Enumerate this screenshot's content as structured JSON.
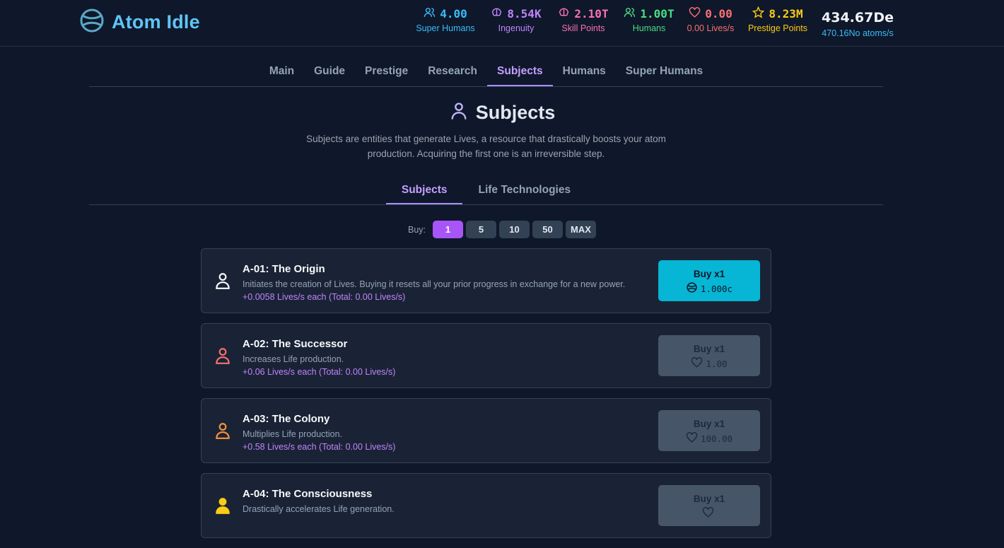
{
  "app": {
    "title": "Atom Idle"
  },
  "stats": [
    {
      "value": "4.00",
      "label": "Super Humans",
      "icon": "users-icon",
      "color": "#38bdf8"
    },
    {
      "value": "8.54K",
      "label": "Ingenuity",
      "icon": "brain-icon",
      "color": "#c084fc"
    },
    {
      "value": "2.10T",
      "label": "Skill Points",
      "icon": "brain-icon",
      "color": "#f472b6"
    },
    {
      "value": "1.00T",
      "label": "Humans",
      "icon": "users-icon",
      "color": "#4ade80"
    },
    {
      "value": "0.00",
      "label": "0.00 Lives/s",
      "icon": "heart-icon",
      "color": "#f87171"
    },
    {
      "value": "8.23M",
      "label": "Prestige Points",
      "icon": "star-icon",
      "color": "#facc15"
    }
  ],
  "atoms": {
    "value": "434.67De",
    "rate": "470.16No atoms/s"
  },
  "nav": {
    "tabs": [
      "Main",
      "Guide",
      "Prestige",
      "Research",
      "Subjects",
      "Humans",
      "Super Humans"
    ],
    "active": "Subjects"
  },
  "page": {
    "title": "Subjects",
    "description": "Subjects are entities that generate Lives, a resource that drastically boosts your atom production. Acquiring the first one is an irreversible step."
  },
  "subtabs": {
    "items": [
      "Subjects",
      "Life Technologies"
    ],
    "active": "Subjects"
  },
  "buy": {
    "label": "Buy:",
    "options": [
      "1",
      "5",
      "10",
      "50",
      "MAX"
    ],
    "active": "1"
  },
  "subjects": [
    {
      "name": "A-01: The Origin",
      "desc": "Initiates the creation of Lives. Buying it resets all your prior progress in exchange for a new power.",
      "prod": "+0.0058 Lives/s each (Total: 0.00 Lives/s)",
      "buy": "Buy x1",
      "cost": "1.000c",
      "cost_icon": "atom-icon",
      "icon_color": "#f8fafc",
      "enabled": true
    },
    {
      "name": "A-02: The Successor",
      "desc": "Increases Life production.",
      "prod": "+0.06 Lives/s each (Total: 0.00 Lives/s)",
      "buy": "Buy x1",
      "cost": "1.00",
      "cost_icon": "heart-icon",
      "icon_color": "#f87171",
      "enabled": false
    },
    {
      "name": "A-03: The Colony",
      "desc": "Multiplies Life production.",
      "prod": "+0.58 Lives/s each (Total: 0.00 Lives/s)",
      "buy": "Buy x1",
      "cost": "100.00",
      "cost_icon": "heart-icon",
      "icon_color": "#fb923c",
      "enabled": false
    },
    {
      "name": "A-04: The Consciousness",
      "desc": "Drastically accelerates Life generation.",
      "prod": "",
      "buy": "Buy x1",
      "cost": "",
      "cost_icon": "heart-icon",
      "icon_color": "#facc15",
      "enabled": false
    }
  ]
}
